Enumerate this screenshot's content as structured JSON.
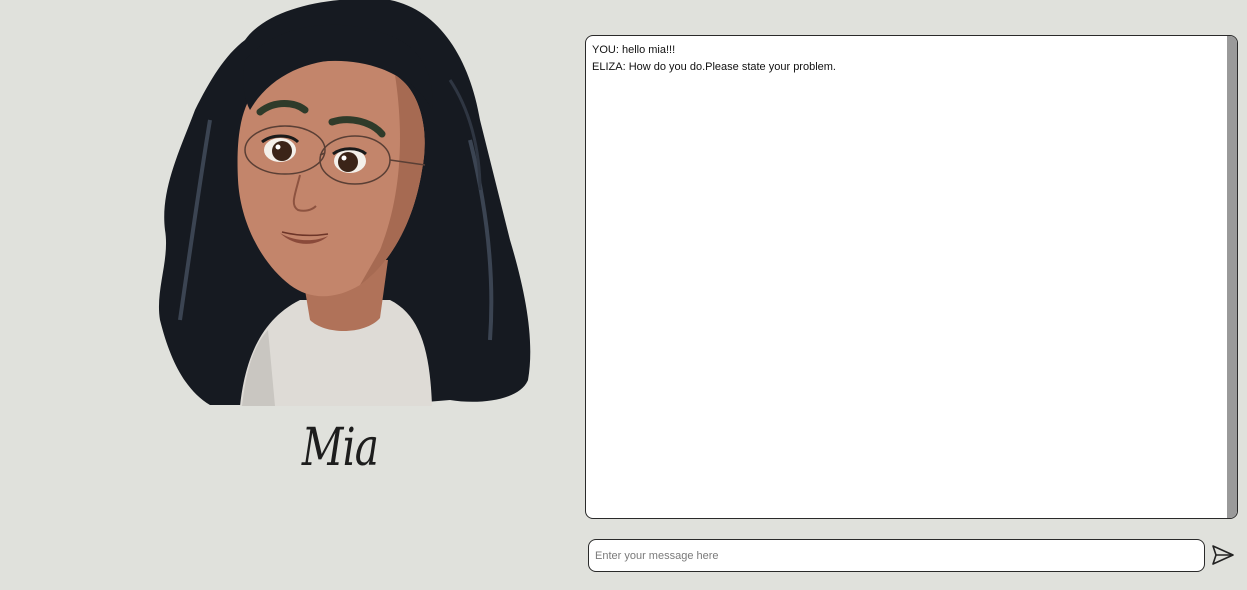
{
  "character": {
    "name": "Mia"
  },
  "chat": {
    "messages": [
      {
        "speaker": "YOU",
        "text": "hello mia!!!"
      },
      {
        "speaker": "ELIZA",
        "text": "How do you do.Please state your problem."
      }
    ]
  },
  "composer": {
    "placeholder": "Enter your message here",
    "value": ""
  },
  "icons": {
    "send": "send-arrow-icon"
  },
  "colors": {
    "background": "#e0e1dc",
    "chat_background": "#ffffff",
    "border": "#2a2a2a",
    "scrollbar": "#9a9a9a"
  }
}
